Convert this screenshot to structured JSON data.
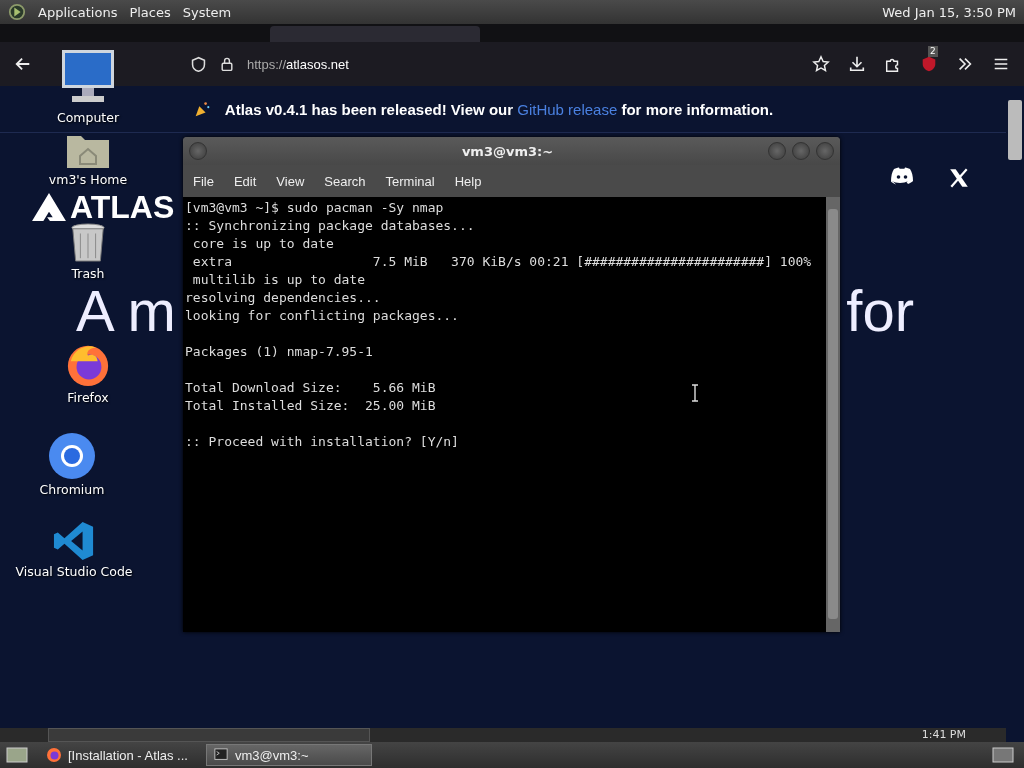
{
  "top_panel": {
    "menus": [
      "Applications",
      "Places",
      "System"
    ],
    "clock": "Wed Jan 15, 3:50 PM"
  },
  "browser": {
    "url_scheme": "https://",
    "url_host": "atlasos.net",
    "extension_badge": "2",
    "banner": {
      "text_start": "Atlas v0.4.1 has been released! View our ",
      "link": "GitHub release",
      "text_end": " for more information."
    },
    "site": {
      "logo": "ATLAS",
      "headline_start": "A m",
      "headline_end": "for"
    }
  },
  "desktop_icons": [
    {
      "label": "Computer",
      "kind": "computer"
    },
    {
      "label": "vm3's Home",
      "kind": "home"
    },
    {
      "label": "Trash",
      "kind": "trash"
    },
    {
      "label": "Firefox",
      "kind": "firefox"
    },
    {
      "label": "Chromium",
      "kind": "chromium"
    },
    {
      "label": "Visual Studio Code",
      "kind": "vscode"
    }
  ],
  "terminal": {
    "title": "vm3@vm3:~",
    "menus": [
      "File",
      "Edit",
      "View",
      "Search",
      "Terminal",
      "Help"
    ],
    "blocks": [
      [
        "[vm3@vm3 ~]$ sudo pacman -Sy nmap",
        ":: Synchronizing package databases...",
        " core is up to date",
        " extra                  7.5 MiB   370 KiB/s 00:21 [#######################] 100%",
        " multilib is up to date",
        "resolving dependencies...",
        "looking for conflicting packages..."
      ],
      [
        "Packages (1) nmap-7.95-1"
      ],
      [
        "Total Download Size:    5.66 MiB",
        "Total Installed Size:  25.00 MiB"
      ],
      [
        ":: Proceed with installation? [Y/n]"
      ]
    ]
  },
  "vm_taskbar": {
    "clock": "1:41 PM"
  },
  "taskbar": {
    "tasks": [
      {
        "label": "[Installation - Atlas ...",
        "kind": "browser",
        "selected": false
      },
      {
        "label": "vm3@vm3:~",
        "kind": "terminal",
        "selected": true
      }
    ]
  }
}
